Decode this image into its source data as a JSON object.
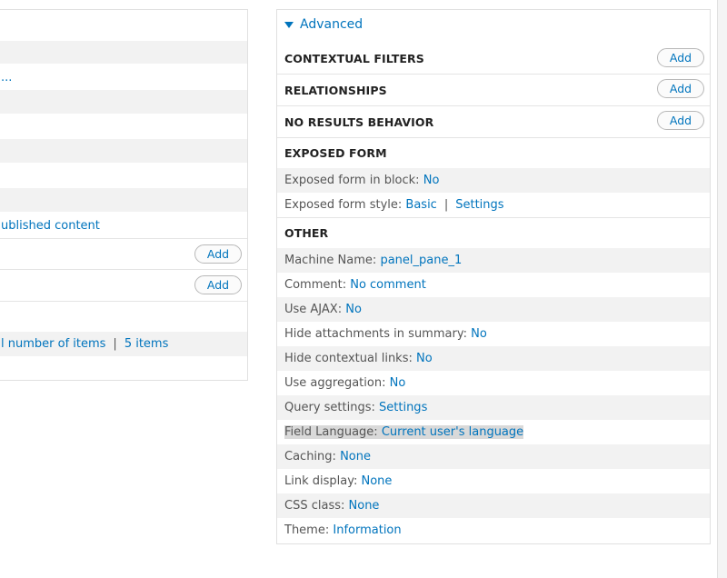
{
  "left": {
    "row_published": "ublished content",
    "row_ellipsis": "...",
    "add_label": "Add",
    "pager_value": "l number of items",
    "pager_items": "5 items",
    "pipe": "|"
  },
  "advanced": {
    "toggle_label": "Advanced",
    "contextual_filters": {
      "title": "CONTEXTUAL FILTERS",
      "add_label": "Add"
    },
    "relationships": {
      "title": "RELATIONSHIPS",
      "add_label": "Add"
    },
    "no_results": {
      "title": "NO RESULTS BEHAVIOR",
      "add_label": "Add"
    },
    "exposed_form": {
      "title": "EXPOSED FORM",
      "in_block_label": "Exposed form in block:",
      "in_block_value": "No",
      "style_label": "Exposed form style:",
      "style_value": "Basic",
      "style_settings": "Settings"
    },
    "other": {
      "title": "OTHER",
      "machine_name_label": "Machine Name:",
      "machine_name_value": "panel_pane_1",
      "comment_label": "Comment:",
      "comment_value": "No comment",
      "ajax_label": "Use AJAX:",
      "ajax_value": "No",
      "hide_attach_label": "Hide attachments in summary:",
      "hide_attach_value": "No",
      "hide_ctx_label": "Hide contextual links:",
      "hide_ctx_value": "No",
      "aggregation_label": "Use aggregation:",
      "aggregation_value": "No",
      "query_label": "Query settings:",
      "query_value": "Settings",
      "field_lang_label": "Field Language:",
      "field_lang_value": "Current user's language",
      "caching_label": "Caching:",
      "caching_value": "None",
      "link_display_label": "Link display:",
      "link_display_value": "None",
      "css_class_label": "CSS class:",
      "css_class_value": "None",
      "theme_label": "Theme:",
      "theme_value": "Information"
    }
  },
  "colors": {
    "link": "#0074bd",
    "row_shade": "#f2f2f2",
    "border": "#e0e0e0",
    "highlight": "#d9d9d9"
  }
}
